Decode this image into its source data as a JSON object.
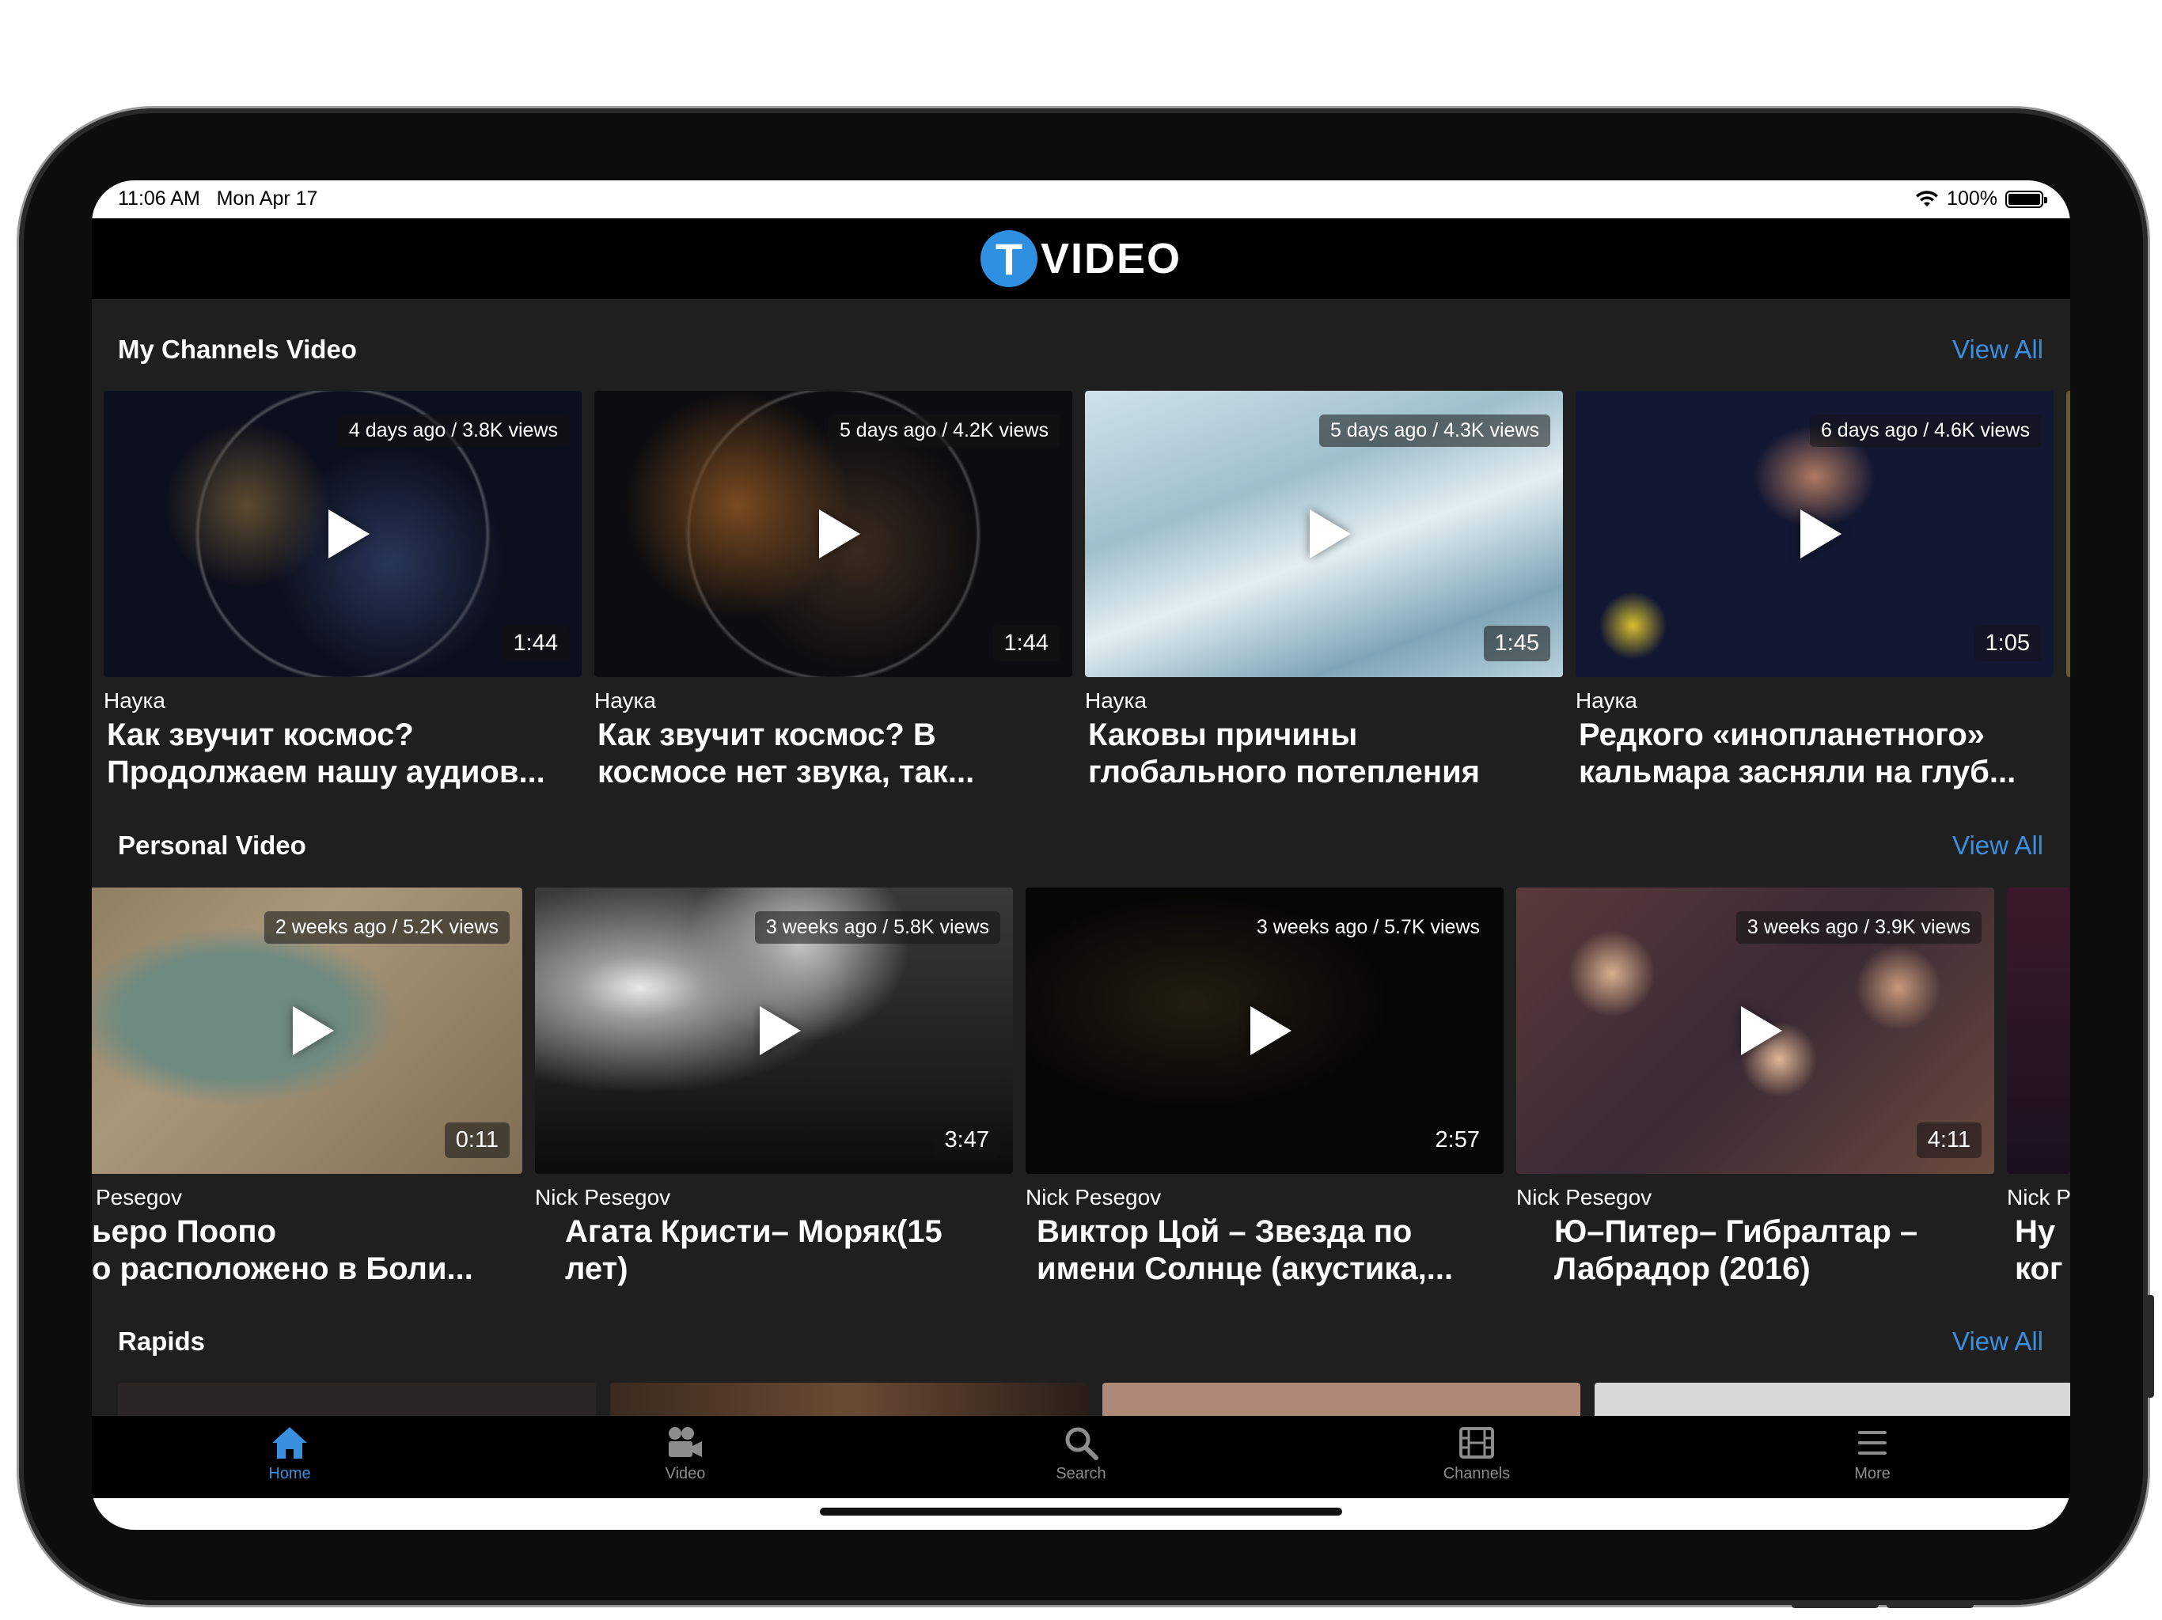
{
  "status_bar": {
    "time": "11:06 AM   Mon Apr 17",
    "battery": "100%"
  },
  "header": {
    "logo_letter": "T",
    "logo_text": "VIDEO"
  },
  "sections": {
    "my_channels": {
      "title": "My Channels Video",
      "view_all": "View All",
      "cards": [
        {
          "meta": "4 days ago / 3.8K views",
          "duration": "1:44",
          "channel": "Наука",
          "title": "Как звучит космос? Продолжаем нашу аудиов..."
        },
        {
          "meta": "5 days ago / 4.2K views",
          "duration": "1:44",
          "channel": "Наука",
          "title": "Как звучит космос? В космосе нет звука, так..."
        },
        {
          "meta": "5 days ago / 4.3K views",
          "duration": "1:45",
          "channel": "Наука",
          "title": "Каковы причины глобального потепления"
        },
        {
          "meta": "6 days ago / 4.6K views",
          "duration": "1:05",
          "channel": "Наука",
          "title": "Редкого «инопланетного» кальмара засняли на глуб..."
        }
      ]
    },
    "personal": {
      "title": "Personal Video",
      "view_all": "View All",
      "cards": [
        {
          "meta": "2 weeks ago / 5.2K views",
          "duration": "0:11",
          "channel": "Pesegov",
          "title": "ьеро Поопо\nо расположено в Боли..."
        },
        {
          "meta": "3 weeks ago / 5.8K views",
          "duration": "3:47",
          "channel": "Nick Pesegov",
          "title": "Агата Кристи– Моряк(15 лет)"
        },
        {
          "meta": "3 weeks ago / 5.7K views",
          "duration": "2:57",
          "channel": "Nick Pesegov",
          "title": "Виктор Цой – Звезда по имени Солнце (акустика,..."
        },
        {
          "meta": "3 weeks ago / 3.9K views",
          "duration": "4:11",
          "channel": "Nick Pesegov",
          "title": "Ю–Питер– Гибралтар – Лабрадор (2016)"
        },
        {
          "channel": "Nick P",
          "title": "Ну\nког"
        }
      ]
    },
    "rapids": {
      "title": "Rapids",
      "view_all": "View All"
    }
  },
  "tabs": [
    {
      "label": "Home",
      "icon": "home-icon",
      "active": true
    },
    {
      "label": "Video",
      "icon": "video-camera-icon"
    },
    {
      "label": "Search",
      "icon": "search-icon"
    },
    {
      "label": "Channels",
      "icon": "film-icon"
    },
    {
      "label": "More",
      "icon": "menu-icon"
    }
  ],
  "colors": {
    "accent": "#3a8fe0",
    "background": "#1f1f1f",
    "header": "#000000"
  }
}
